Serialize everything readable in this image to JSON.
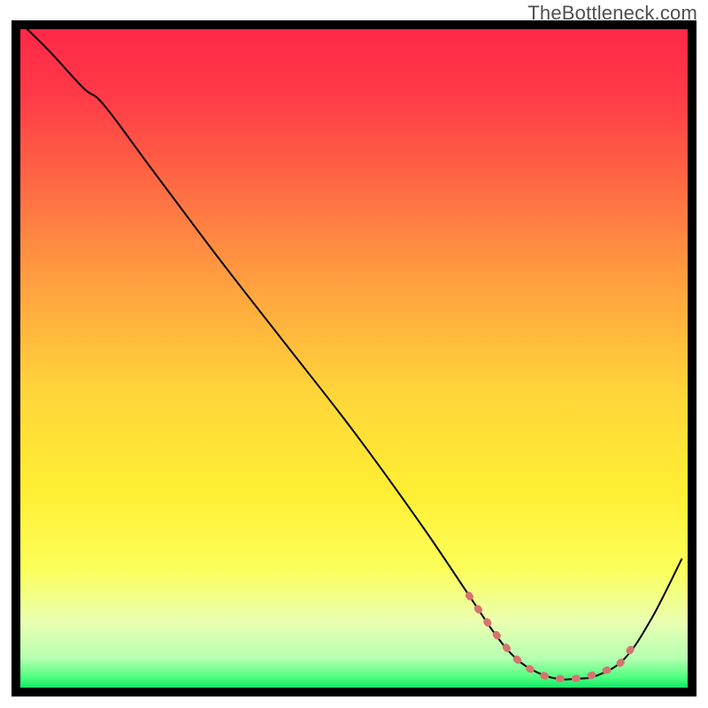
{
  "watermark": "TheBottleneck.com",
  "chart_data": {
    "type": "line",
    "title": "",
    "xlabel": "",
    "ylabel": "",
    "xlim": [
      0,
      100
    ],
    "ylim": [
      0,
      100
    ],
    "grid": false,
    "plot_bg": {
      "stops": [
        {
          "offset": 0.0,
          "color": "#ff2848"
        },
        {
          "offset": 0.1,
          "color": "#ff3a47"
        },
        {
          "offset": 0.25,
          "color": "#ff6f44"
        },
        {
          "offset": 0.4,
          "color": "#ffa53f"
        },
        {
          "offset": 0.55,
          "color": "#ffd53a"
        },
        {
          "offset": 0.7,
          "color": "#ffee33"
        },
        {
          "offset": 0.82,
          "color": "#fcff5a"
        },
        {
          "offset": 0.9,
          "color": "#eaffb1"
        },
        {
          "offset": 0.955,
          "color": "#b7ffb1"
        },
        {
          "offset": 0.985,
          "color": "#4dff7d"
        },
        {
          "offset": 1.0,
          "color": "#15e668"
        }
      ]
    },
    "series": [
      {
        "name": "curve",
        "stroke": "#000000",
        "stroke_width": 2,
        "x": [
          1.0,
          5,
          10,
          13,
          20,
          30,
          40,
          50,
          60,
          67,
          71,
          74,
          77,
          80,
          83,
          86,
          90,
          94,
          98.5
        ],
        "y": [
          100,
          96,
          90.5,
          88,
          78.5,
          65,
          52,
          39,
          25,
          14.5,
          8.5,
          5,
          3,
          2,
          2,
          2.5,
          5,
          11,
          20
        ]
      },
      {
        "name": "minimum-band",
        "stroke": "#d6746f",
        "stroke_width": 8,
        "linecap": "round",
        "dash": "2 16",
        "x": [
          67,
          69,
          71.5,
          74,
          76.5,
          79,
          81.5,
          84,
          86.5,
          89,
          91
        ],
        "y": [
          14.5,
          11.5,
          8,
          5,
          3.2,
          2.2,
          2,
          2.2,
          3,
          4,
          6.5
        ]
      }
    ]
  }
}
